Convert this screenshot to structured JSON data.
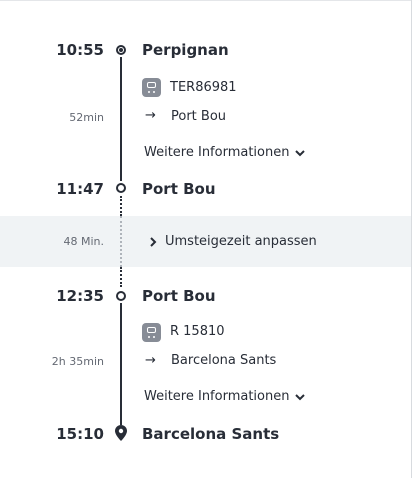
{
  "journey": {
    "legs": [
      {
        "dep_time": "10:55",
        "dep_station": "Perpignan",
        "duration": "52min",
        "train": "TER86981",
        "direction": "Port Bou",
        "more_info": "Weitere Informationen",
        "arr_time": "11:47",
        "arr_station": "Port Bou"
      },
      {
        "dep_time": "12:35",
        "dep_station": "Port Bou",
        "duration": "2h 35min",
        "train": "R 15810",
        "direction": "Barcelona Sants",
        "more_info": "Weitere Informationen",
        "arr_time": "15:10",
        "arr_station": "Barcelona Sants"
      }
    ],
    "transfer": {
      "duration": "48 Min.",
      "action": "Umsteigezeit anpassen"
    },
    "icons": [
      "origin-node-icon",
      "stop-node-icon",
      "train-icon",
      "arrow-right-icon",
      "chevron-down-icon",
      "chevron-right-icon",
      "location-pin-icon"
    ]
  }
}
